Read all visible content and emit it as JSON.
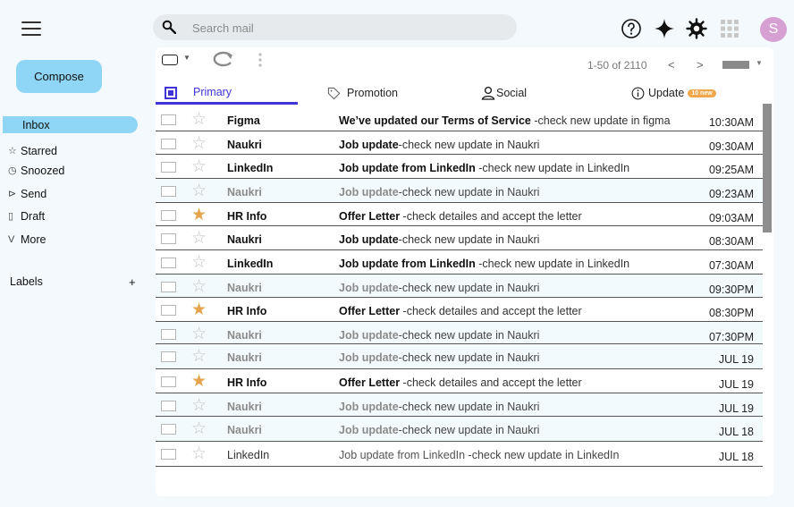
{
  "search": {
    "placeholder": "Search mail"
  },
  "user": {
    "avatar_letter": "S",
    "avatar_color": "#d6a0d2"
  },
  "sidebar": {
    "compose_label": "Compose",
    "items": [
      {
        "label": "Inbox",
        "icon": "inbox-icon",
        "active": true
      },
      {
        "label": "Starred",
        "icon": "star-icon"
      },
      {
        "label": "Snoozed",
        "icon": "clock-icon"
      },
      {
        "label": "Send",
        "icon": "send-icon"
      },
      {
        "label": "Draft",
        "icon": "file-icon"
      },
      {
        "label": "More",
        "icon": "chevron-down-icon"
      }
    ],
    "labels_title": "Labels",
    "labels_add": "+"
  },
  "toolbar": {
    "pager": "1-50 of 2110",
    "prev": "<",
    "next": ">"
  },
  "tabs": [
    {
      "label": "Primary",
      "icon": "inbox-square-icon",
      "active": true
    },
    {
      "label": "Promotion",
      "icon": "tag-icon"
    },
    {
      "label": "Social",
      "icon": "person-icon"
    },
    {
      "label": "Update",
      "icon": "info-icon",
      "badge": "10 new"
    }
  ],
  "colors": {
    "accent": "#3f35d6",
    "compose": "#8fd6f6",
    "star_on": "#e5a44c",
    "badge": "#f0a64a"
  },
  "emails": [
    {
      "sender": "Figma",
      "subject": "We’ve updated our Terms of Service",
      "snippet": " -check new update in figma",
      "time": "10:30AM",
      "starred": false,
      "style": "unread"
    },
    {
      "sender": "Naukri",
      "subject": "Job update",
      "snippet": "-check new update in  Naukri",
      "time": "09:30AM",
      "starred": false,
      "style": "unread"
    },
    {
      "sender": "LinkedIn",
      "subject": "Job update from LinkedIn",
      "snippet": "  -check new update in  LinkedIn",
      "time": "09:25AM",
      "starred": false,
      "style": "unread"
    },
    {
      "sender": "Naukri",
      "subject": "Job update",
      "snippet": "-check new update in  Naukri",
      "time": "09:23AM",
      "starred": false,
      "style": "read"
    },
    {
      "sender": "HR Info",
      "subject": "Offer Letter",
      "snippet": " -check detailes and accept the letter",
      "time": "09:03AM",
      "starred": true,
      "style": "unread"
    },
    {
      "sender": "Naukri",
      "subject": "Job update",
      "snippet": "-check new update in  Naukri",
      "time": "08:30AM",
      "starred": false,
      "style": "unread"
    },
    {
      "sender": "LinkedIn",
      "subject": "Job update from LinkedIn",
      "snippet": "  -check new update in  LinkedIn",
      "time": "07:30AM",
      "starred": false,
      "style": "unread"
    },
    {
      "sender": "Naukri",
      "subject": "Job update",
      "snippet": "-check new update in  Naukri",
      "time": "09:30PM",
      "starred": false,
      "style": "read"
    },
    {
      "sender": "HR Info",
      "subject": "Offer Letter",
      "snippet": " -check detailes and accept the letter",
      "time": "08:30PM",
      "starred": true,
      "style": "unread"
    },
    {
      "sender": "Naukri",
      "subject": "Job update",
      "snippet": "-check new update in  Naukri",
      "time": "07:30PM",
      "starred": false,
      "style": "read"
    },
    {
      "sender": "Naukri",
      "subject": "Job update",
      "snippet": "-check new update in  Naukri",
      "time": "JUL 19",
      "starred": false,
      "style": "read"
    },
    {
      "sender": "HR Info",
      "subject": "Offer Letter",
      "snippet": " -check detailes and accept the letter",
      "time": "JUL 19",
      "starred": true,
      "style": "unread"
    },
    {
      "sender": "Naukri",
      "subject": "Job update",
      "snippet": "-check new update in  Naukri",
      "time": "JUL 19",
      "starred": false,
      "style": "read"
    },
    {
      "sender": "Naukri",
      "subject": "Job update",
      "snippet": "-check new update in  Naukri",
      "time": "JUL 18",
      "starred": false,
      "style": "read"
    },
    {
      "sender": "LinkedIn",
      "subject": "Job update from LinkedIn",
      "snippet": "  -check new update in  LinkedIn",
      "time": "JUL 18",
      "starred": false,
      "style": "plain"
    }
  ]
}
